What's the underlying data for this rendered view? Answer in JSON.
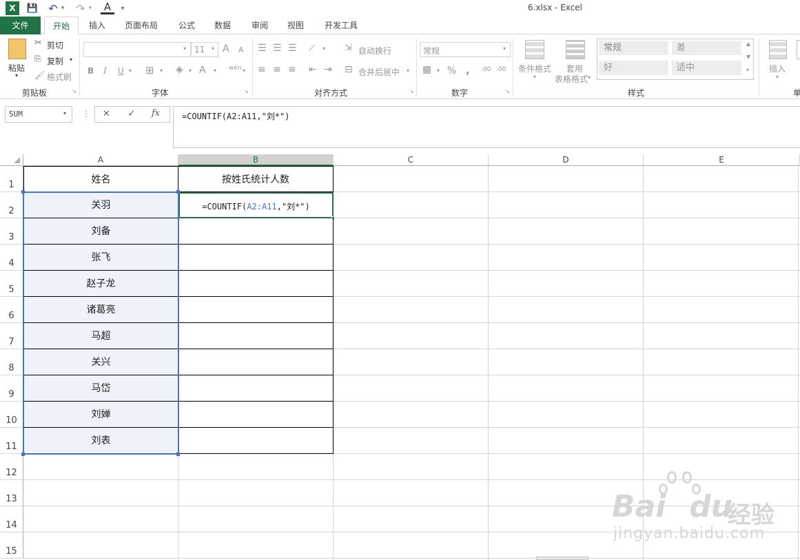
{
  "window": {
    "title": "6.xlsx - Excel"
  },
  "qat": {
    "excel_logo": "X",
    "save": "💾",
    "undo": "↶",
    "redo": "↷",
    "font_color": "A",
    "customize": "▾"
  },
  "tabs": [
    "文件",
    "开始",
    "插入",
    "页面布局",
    "公式",
    "数据",
    "审阅",
    "视图",
    "开发工具"
  ],
  "ribbon": {
    "clipboard": {
      "paste": "粘贴",
      "cut": "剪切",
      "copy": "复制",
      "format_painter": "格式刷",
      "label": "剪贴板"
    },
    "font": {
      "size": "11",
      "bold": "B",
      "italic": "I",
      "underline": "U",
      "grow": "A",
      "shrink": "A",
      "wen": "wén",
      "label": "字体"
    },
    "alignment": {
      "wrap": "自动换行",
      "merge": "合并后居中",
      "label": "对齐方式"
    },
    "number": {
      "format": "常规",
      "percent": "%",
      "comma": ",",
      "inc": ".00",
      "dec": ".00",
      "label": "数字"
    },
    "styles": {
      "conditional": "条件格式",
      "table_line1": "套用",
      "table_line2": "表格格式",
      "normal": "常规",
      "bad": "差",
      "good": "好",
      "neutral": "适中",
      "label": "样式"
    },
    "cells": {
      "insert": "插入",
      "label": "单"
    }
  },
  "formula_bar": {
    "name_box": "SUM",
    "cancel": "✕",
    "enter": "✓",
    "fx": "fx",
    "formula": "=COUNTIF(A2:A11,\"刘*\")"
  },
  "columns": [
    "A",
    "B",
    "C",
    "D",
    "E"
  ],
  "rows": [
    "1",
    "2",
    "3",
    "4",
    "5",
    "6",
    "7",
    "8",
    "9",
    "10",
    "11",
    "12",
    "13",
    "14",
    "15"
  ],
  "sheet": {
    "header_a": "姓名",
    "header_b": "按姓氏统计人数",
    "names": [
      "关羽",
      "刘备",
      "张飞",
      "赵子龙",
      "诸葛亮",
      "马超",
      "关兴",
      "马岱",
      "刘婵",
      "刘表"
    ],
    "b2_prefix": "=COUNTIF(",
    "b2_ref": "A2:A11",
    "b2_suffix": ",\"刘*\")"
  },
  "watermark": {
    "brand": "Bai",
    "brand2": "du",
    "cn": "经验",
    "url": "jingyan.baidu.com"
  },
  "colors": {
    "accent": "#217346",
    "ref_blue": "#4472c4"
  }
}
